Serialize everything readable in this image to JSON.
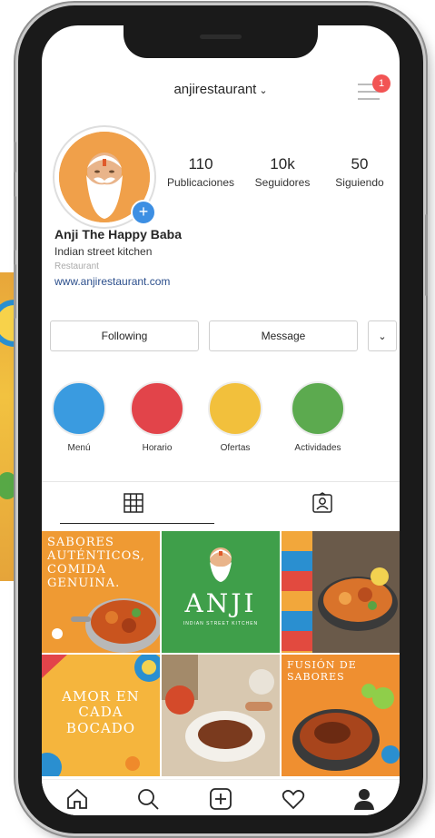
{
  "header": {
    "username": "anjirestaurant",
    "notification_count": "1"
  },
  "profile": {
    "stats": [
      {
        "value": "110",
        "label": "Publicaciones"
      },
      {
        "value": "10k",
        "label": "Seguidores"
      },
      {
        "value": "50",
        "label": "Siguiendo"
      }
    ],
    "name": "Anji The Happy Baba",
    "description": "Indian street kitchen",
    "category": "Restaurant",
    "website": "www.anjirestaurant.com"
  },
  "actions": {
    "following_label": "Following",
    "message_label": "Message"
  },
  "highlights": [
    {
      "label": "Menú",
      "color": "#3a9be0"
    },
    {
      "label": "Horario",
      "color": "#e2444a"
    },
    {
      "label": "Ofertas",
      "color": "#f2c03c"
    },
    {
      "label": "Actividades",
      "color": "#5caa4f"
    }
  ],
  "tabs": [
    {
      "icon": "grid-icon",
      "active": true
    },
    {
      "icon": "tagged-icon",
      "active": false
    }
  ],
  "posts": {
    "tile1_text": "SABORES AUTÉNTICOS, COMIDA GENUINA.",
    "tile2_logo": "ANJI",
    "tile2_sub": "INDIAN STREET KITCHEN",
    "tile4_text": "AMOR EN CADA BOCADO",
    "tile6_text": "FUSIÓN DE SABORES"
  },
  "nav": [
    "home-icon",
    "search-icon",
    "add-post-icon",
    "heart-icon",
    "profile-icon"
  ]
}
